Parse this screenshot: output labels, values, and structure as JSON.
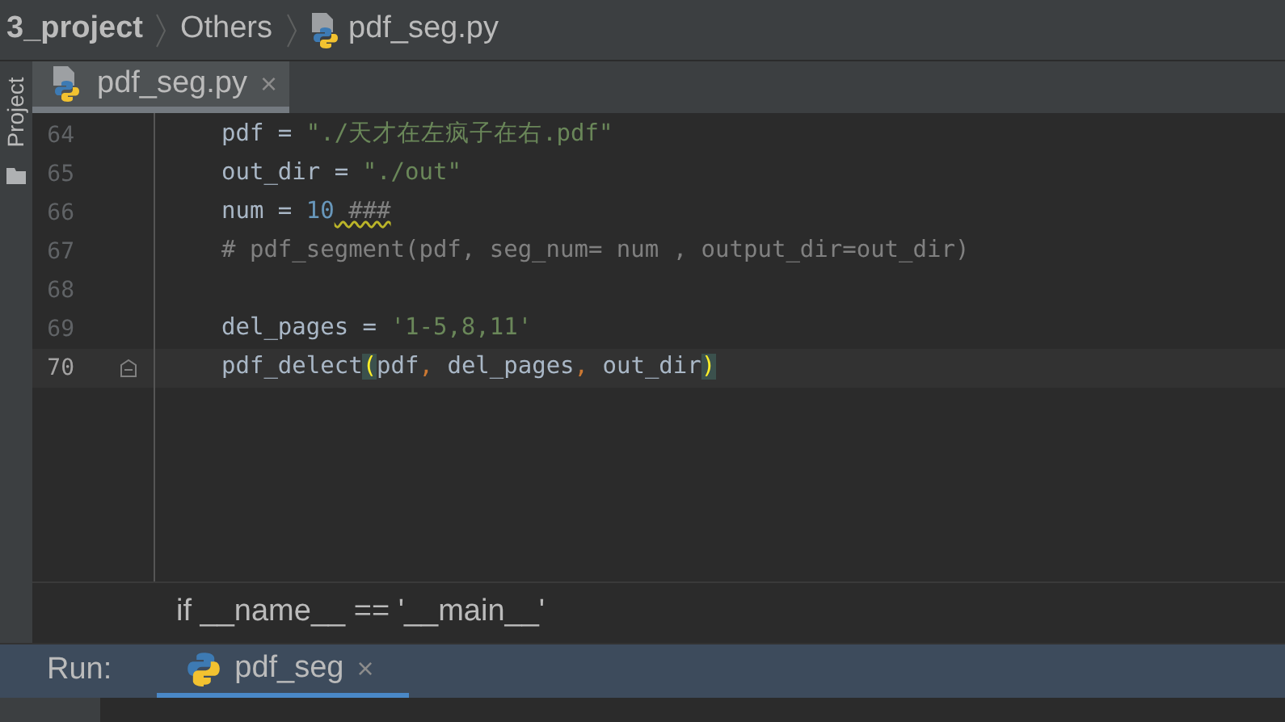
{
  "breadcrumb": [
    {
      "label": "3_project",
      "kind": "project"
    },
    {
      "label": "Others",
      "kind": "folder"
    },
    {
      "label": "pdf_seg.py",
      "kind": "file"
    }
  ],
  "side_tool": {
    "label": "Project"
  },
  "editor_tabs": [
    {
      "label": "pdf_seg.py",
      "close": "×",
      "selected": true
    }
  ],
  "code_lines": [
    {
      "number": "64",
      "current": false,
      "tokens": [
        {
          "text": "pdf = ",
          "kind": "plain"
        },
        {
          "text": "\"./天才在左疯子在右.pdf\"",
          "kind": "string"
        }
      ]
    },
    {
      "number": "65",
      "current": false,
      "tokens": [
        {
          "text": "out_dir = ",
          "kind": "plain"
        },
        {
          "text": "\"./out\"",
          "kind": "string"
        }
      ]
    },
    {
      "number": "66",
      "current": false,
      "tokens": [
        {
          "text": "num = ",
          "kind": "plain"
        },
        {
          "text": "10",
          "kind": "number"
        },
        {
          "text": " ###",
          "kind": "warning"
        }
      ]
    },
    {
      "number": "67",
      "current": false,
      "tokens": [
        {
          "text": "# pdf_segment(pdf, seg_num= num , output_dir=out_dir)",
          "kind": "comment"
        }
      ]
    },
    {
      "number": "68",
      "current": false
    },
    {
      "number": "69",
      "current": false,
      "tokens": [
        {
          "text": "del_pages = ",
          "kind": "plain"
        },
        {
          "text": "'1-5,8,11'",
          "kind": "string"
        }
      ]
    },
    {
      "number": "70",
      "current": true,
      "tokens": [
        {
          "text": "pdf_delect",
          "kind": "plain"
        },
        {
          "text": "(",
          "kind": "bracket"
        },
        {
          "text": "pdf",
          "kind": "plain"
        },
        {
          "text": ",",
          "kind": "comma"
        },
        {
          "text": " del_pages",
          "kind": "plain"
        },
        {
          "text": ",",
          "kind": "comma"
        },
        {
          "text": " out_dir",
          "kind": "plain"
        },
        {
          "text": ")",
          "kind": "bracket"
        }
      ]
    }
  ],
  "scope_breadcrumb": {
    "label": "if __name__ == '__main__'"
  },
  "run_panel": {
    "label": "Run:",
    "tabs": [
      {
        "label": "pdf_seg",
        "close": "×",
        "selected": true
      }
    ]
  }
}
